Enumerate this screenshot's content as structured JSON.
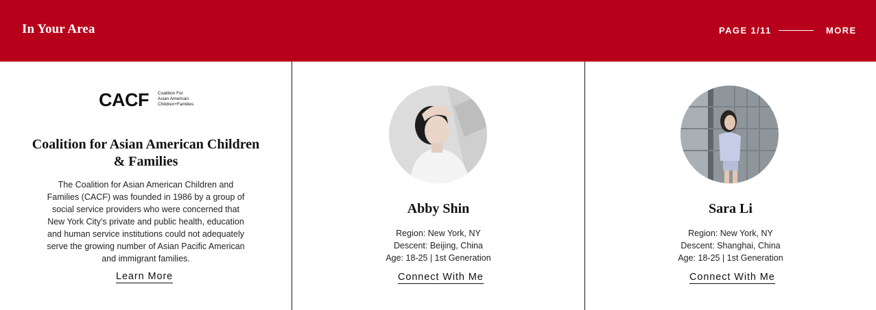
{
  "header": {
    "title": "In Your Area",
    "pager": "PAGE 1/11",
    "more_label": "MORE",
    "background": "#b7001a"
  },
  "organization": {
    "logo_mark": "CACF",
    "logo_sub": [
      "Coalition For",
      "Asian American",
      "Children+Families"
    ],
    "name": "Coalition for Asian American Children & Families",
    "description": "The Coalition for Asian American Children and Families (CACF) was founded in 1986 by a group of social service providers who were concerned that New York City's private and public health, education and human service institutions could not adequately serve the growing number of Asian Pacific American and immigrant families.",
    "link_label": "Learn More"
  },
  "profiles": [
    {
      "name": "Abby Shin",
      "region": "Region: New York, NY",
      "descent": "Descent: Beijing, China",
      "age": "Age: 18-25 | 1st Generation",
      "link_label": "Connect With Me"
    },
    {
      "name": "Sara Li",
      "region": "Region: New York, NY",
      "descent": "Descent: Shanghai, China",
      "age": "Age: 18-25 | 1st Generation",
      "link_label": "Connect With Me"
    }
  ]
}
